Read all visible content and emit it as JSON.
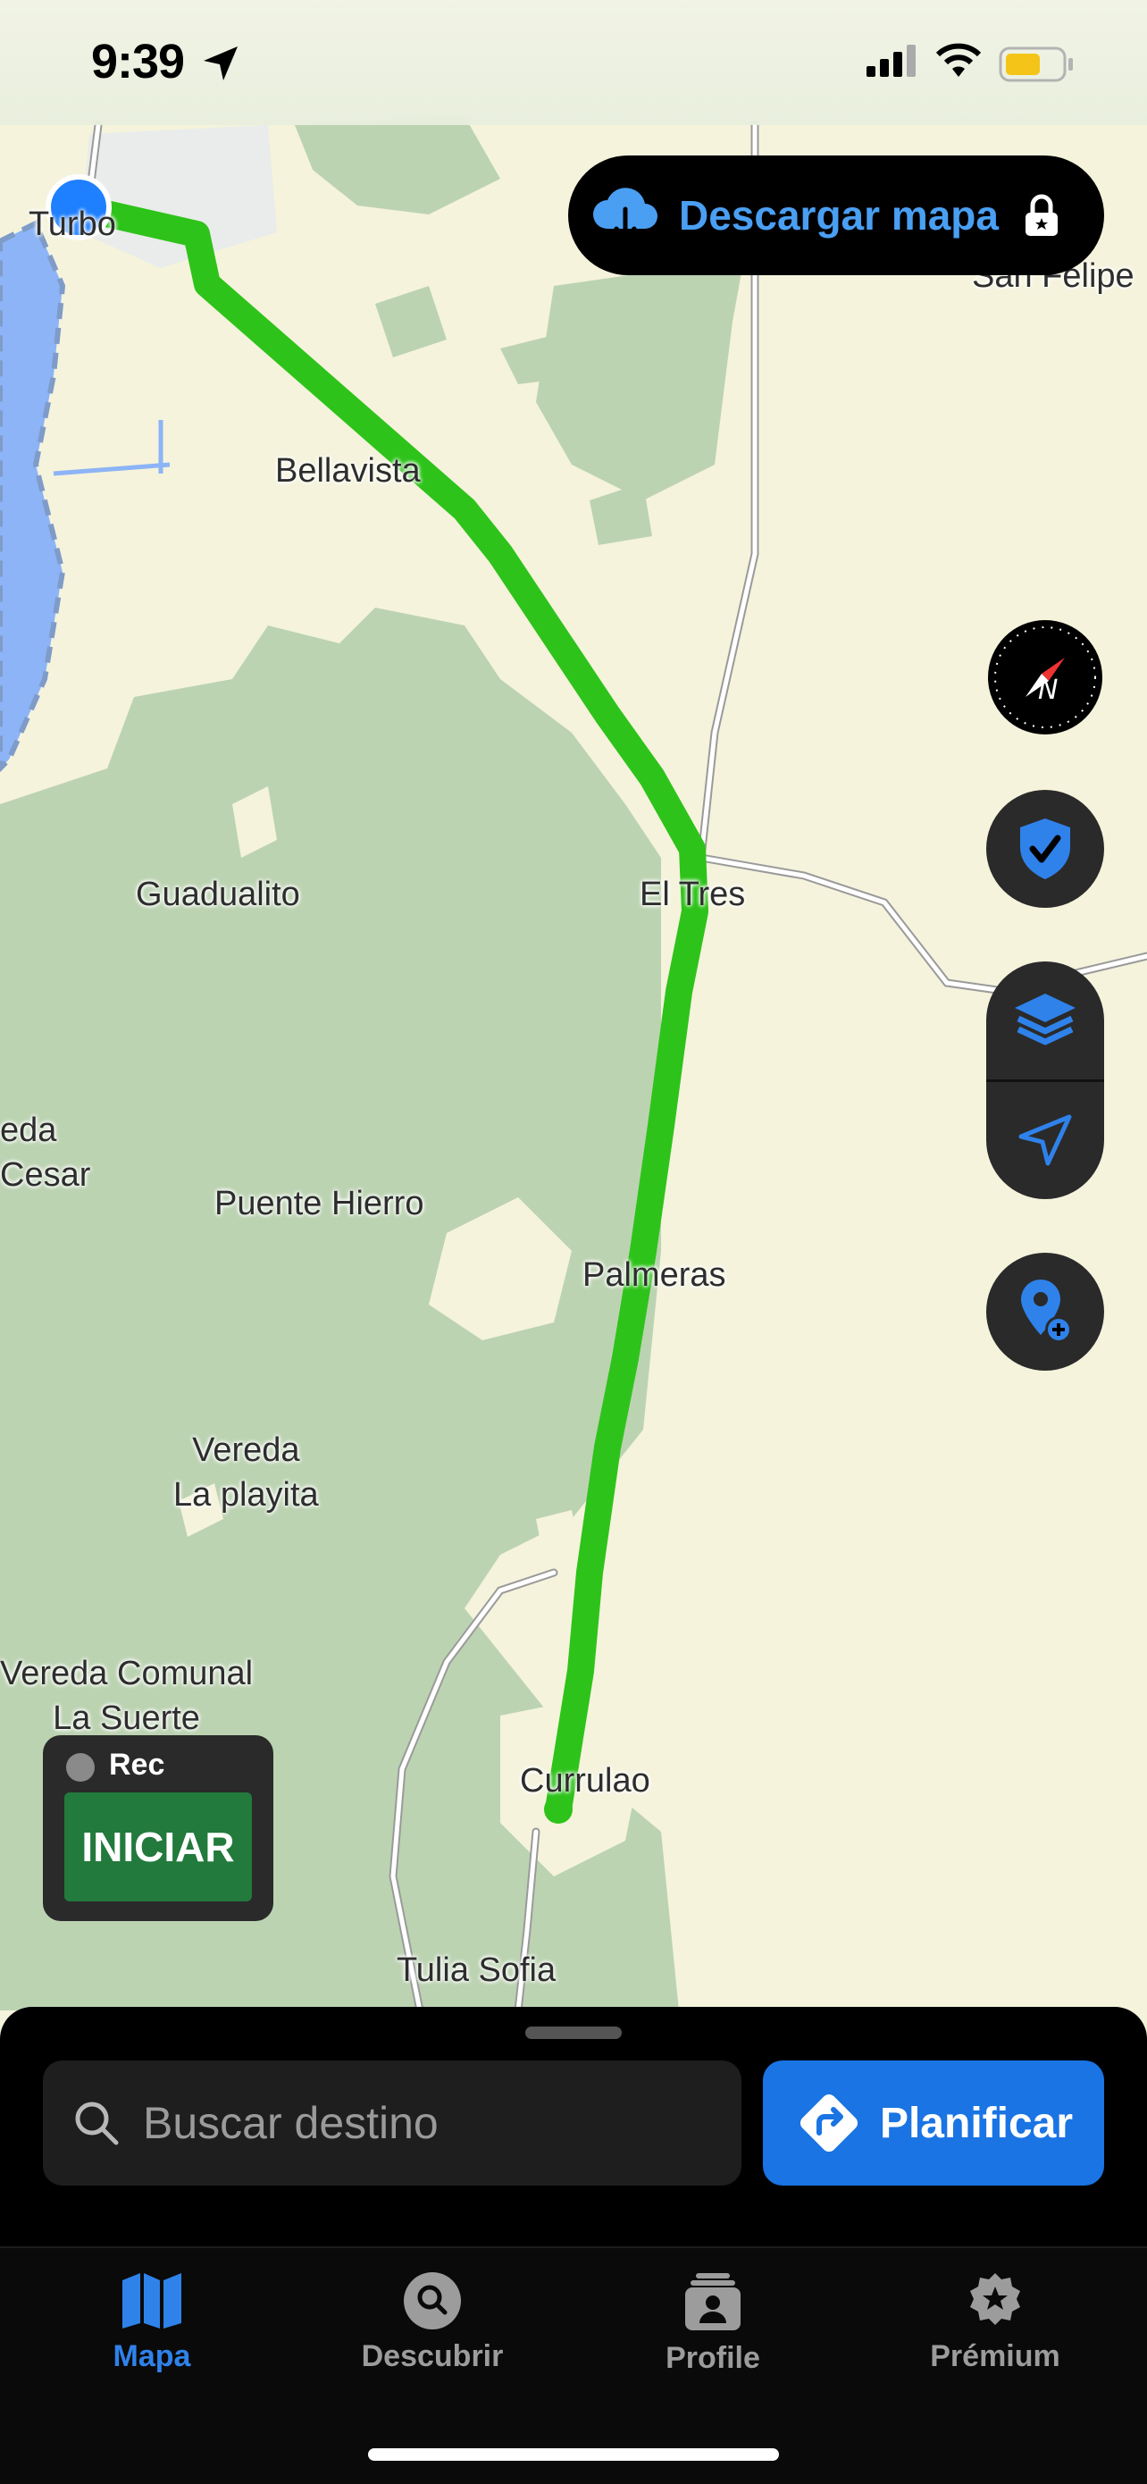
{
  "status_bar": {
    "time": "9:39"
  },
  "map": {
    "labels": [
      "Turbo",
      "Bellavista",
      "San Felipe",
      "Guadualito",
      "El Tres",
      "eda\nCesar",
      "Puente Hierro",
      "Palmeras",
      "Vereda\nLa playita",
      "Vereda Comunal\nLa Suerte",
      "Currulao",
      "Tulia Sofia"
    ],
    "route_color": "#2ec31a",
    "land_color": "#f5f3dc",
    "forest_color": "#bcd3b2",
    "water_color": "#8cb4f6"
  },
  "download_button": {
    "label": "Descargar mapa",
    "icon": "cloud-download-icon",
    "lock_icon": "lock-icon"
  },
  "map_controls": {
    "compass": "compass-icon",
    "shield": "shield-check-icon",
    "layers": "layers-icon",
    "locate": "navigation-arrow-icon",
    "add_place": "add-location-pin-icon"
  },
  "recorder": {
    "status": "Rec",
    "start_label": "INICIAR"
  },
  "bottom_sheet": {
    "search_placeholder": "Buscar destino",
    "plan_label": "Planificar"
  },
  "tabs": [
    {
      "label": "Mapa",
      "icon": "map-icon",
      "active": true
    },
    {
      "label": "Descubrir",
      "icon": "search-circle-icon",
      "active": false
    },
    {
      "label": "Profile",
      "icon": "profile-card-icon",
      "active": false
    },
    {
      "label": "Prémium",
      "icon": "star-badge-icon",
      "active": false
    }
  ],
  "accent_color": "#2f82ea"
}
